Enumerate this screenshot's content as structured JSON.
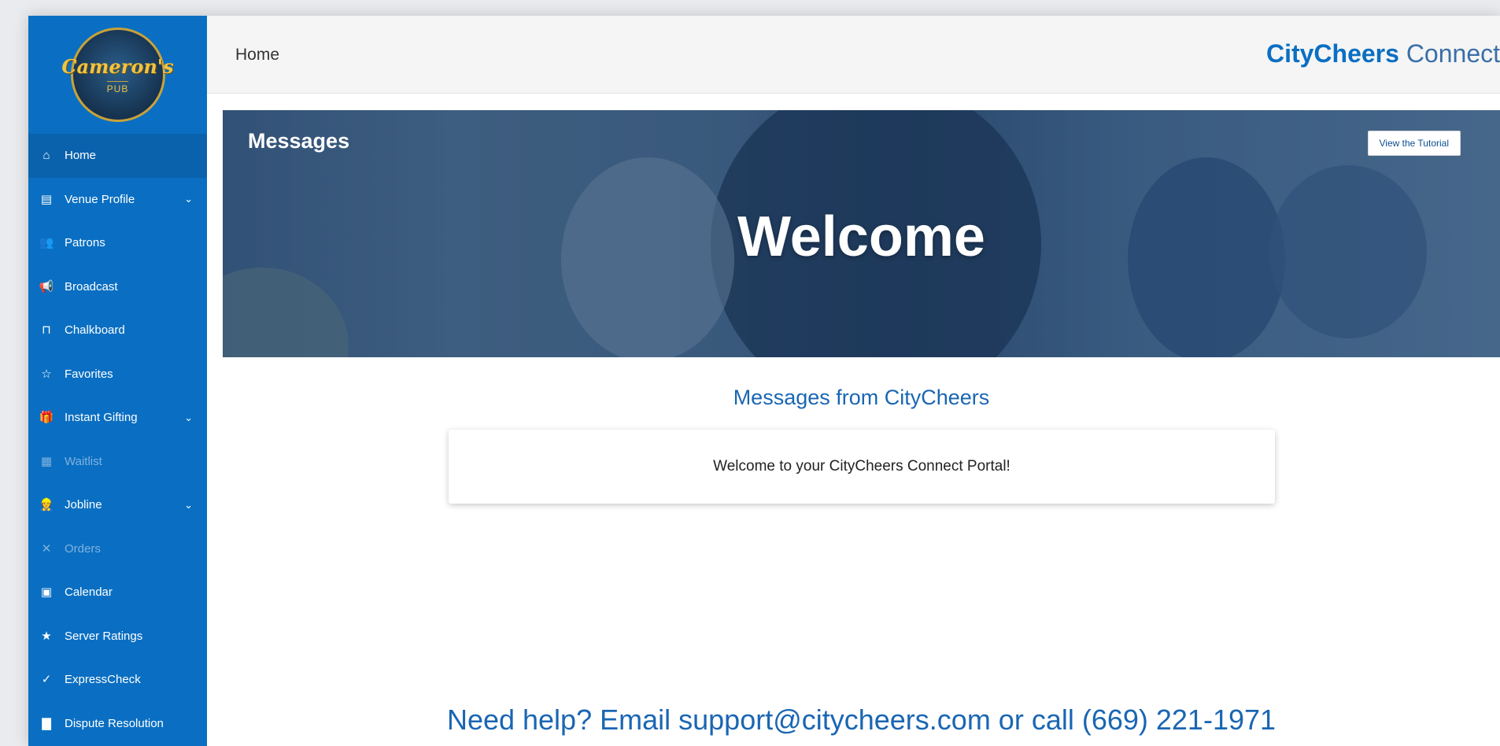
{
  "sidebar": {
    "logo": {
      "name": "Cameron's",
      "sub": "PUB"
    },
    "items": [
      {
        "label": "Home",
        "icon": "home-icon",
        "glyph": "⌂",
        "active": true,
        "disabled": false,
        "has_chevron": false
      },
      {
        "label": "Venue Profile",
        "icon": "venue-icon",
        "glyph": "▤",
        "active": false,
        "disabled": false,
        "has_chevron": true
      },
      {
        "label": "Patrons",
        "icon": "patrons-icon",
        "glyph": "👥",
        "active": false,
        "disabled": false,
        "has_chevron": false
      },
      {
        "label": "Broadcast",
        "icon": "broadcast-icon",
        "glyph": "📢",
        "active": false,
        "disabled": false,
        "has_chevron": false
      },
      {
        "label": "Chalkboard",
        "icon": "chalkboard-icon",
        "glyph": "⊓",
        "active": false,
        "disabled": false,
        "has_chevron": false
      },
      {
        "label": "Favorites",
        "icon": "star-icon",
        "glyph": "☆",
        "active": false,
        "disabled": false,
        "has_chevron": false
      },
      {
        "label": "Instant Gifting",
        "icon": "gift-icon",
        "glyph": "🎁",
        "active": false,
        "disabled": false,
        "has_chevron": true
      },
      {
        "label": "Waitlist",
        "icon": "waitlist-icon",
        "glyph": "▦",
        "active": false,
        "disabled": true,
        "has_chevron": false
      },
      {
        "label": "Jobline",
        "icon": "jobline-icon",
        "glyph": "👷",
        "active": false,
        "disabled": false,
        "has_chevron": true
      },
      {
        "label": "Orders",
        "icon": "orders-icon",
        "glyph": "✕",
        "active": false,
        "disabled": true,
        "has_chevron": false
      },
      {
        "label": "Calendar",
        "icon": "calendar-icon",
        "glyph": "▣",
        "active": false,
        "disabled": false,
        "has_chevron": false
      },
      {
        "label": "Server Ratings",
        "icon": "ratings-icon",
        "glyph": "★",
        "active": false,
        "disabled": false,
        "has_chevron": false
      },
      {
        "label": "ExpressCheck",
        "icon": "check-icon",
        "glyph": "✓",
        "active": false,
        "disabled": false,
        "has_chevron": false
      },
      {
        "label": "Dispute Resolution",
        "icon": "dispute-icon",
        "glyph": "▇",
        "active": false,
        "disabled": false,
        "has_chevron": false
      }
    ]
  },
  "header": {
    "breadcrumb": "Home",
    "brand_bold": "CityCheers",
    "brand_light": "Connect"
  },
  "banner": {
    "section_title": "Messages",
    "welcome": "Welcome",
    "tutorial_button": "View the Tutorial"
  },
  "main": {
    "messages_heading": "Messages from CityCheers",
    "message_text": "Welcome to your CityCheers Connect Portal!",
    "help_text": "Need help? Email support@citycheers.com or call (669) 221-1971"
  },
  "colors": {
    "sidebar_bg": "#0a6fc2",
    "accent": "#1a66b3"
  }
}
